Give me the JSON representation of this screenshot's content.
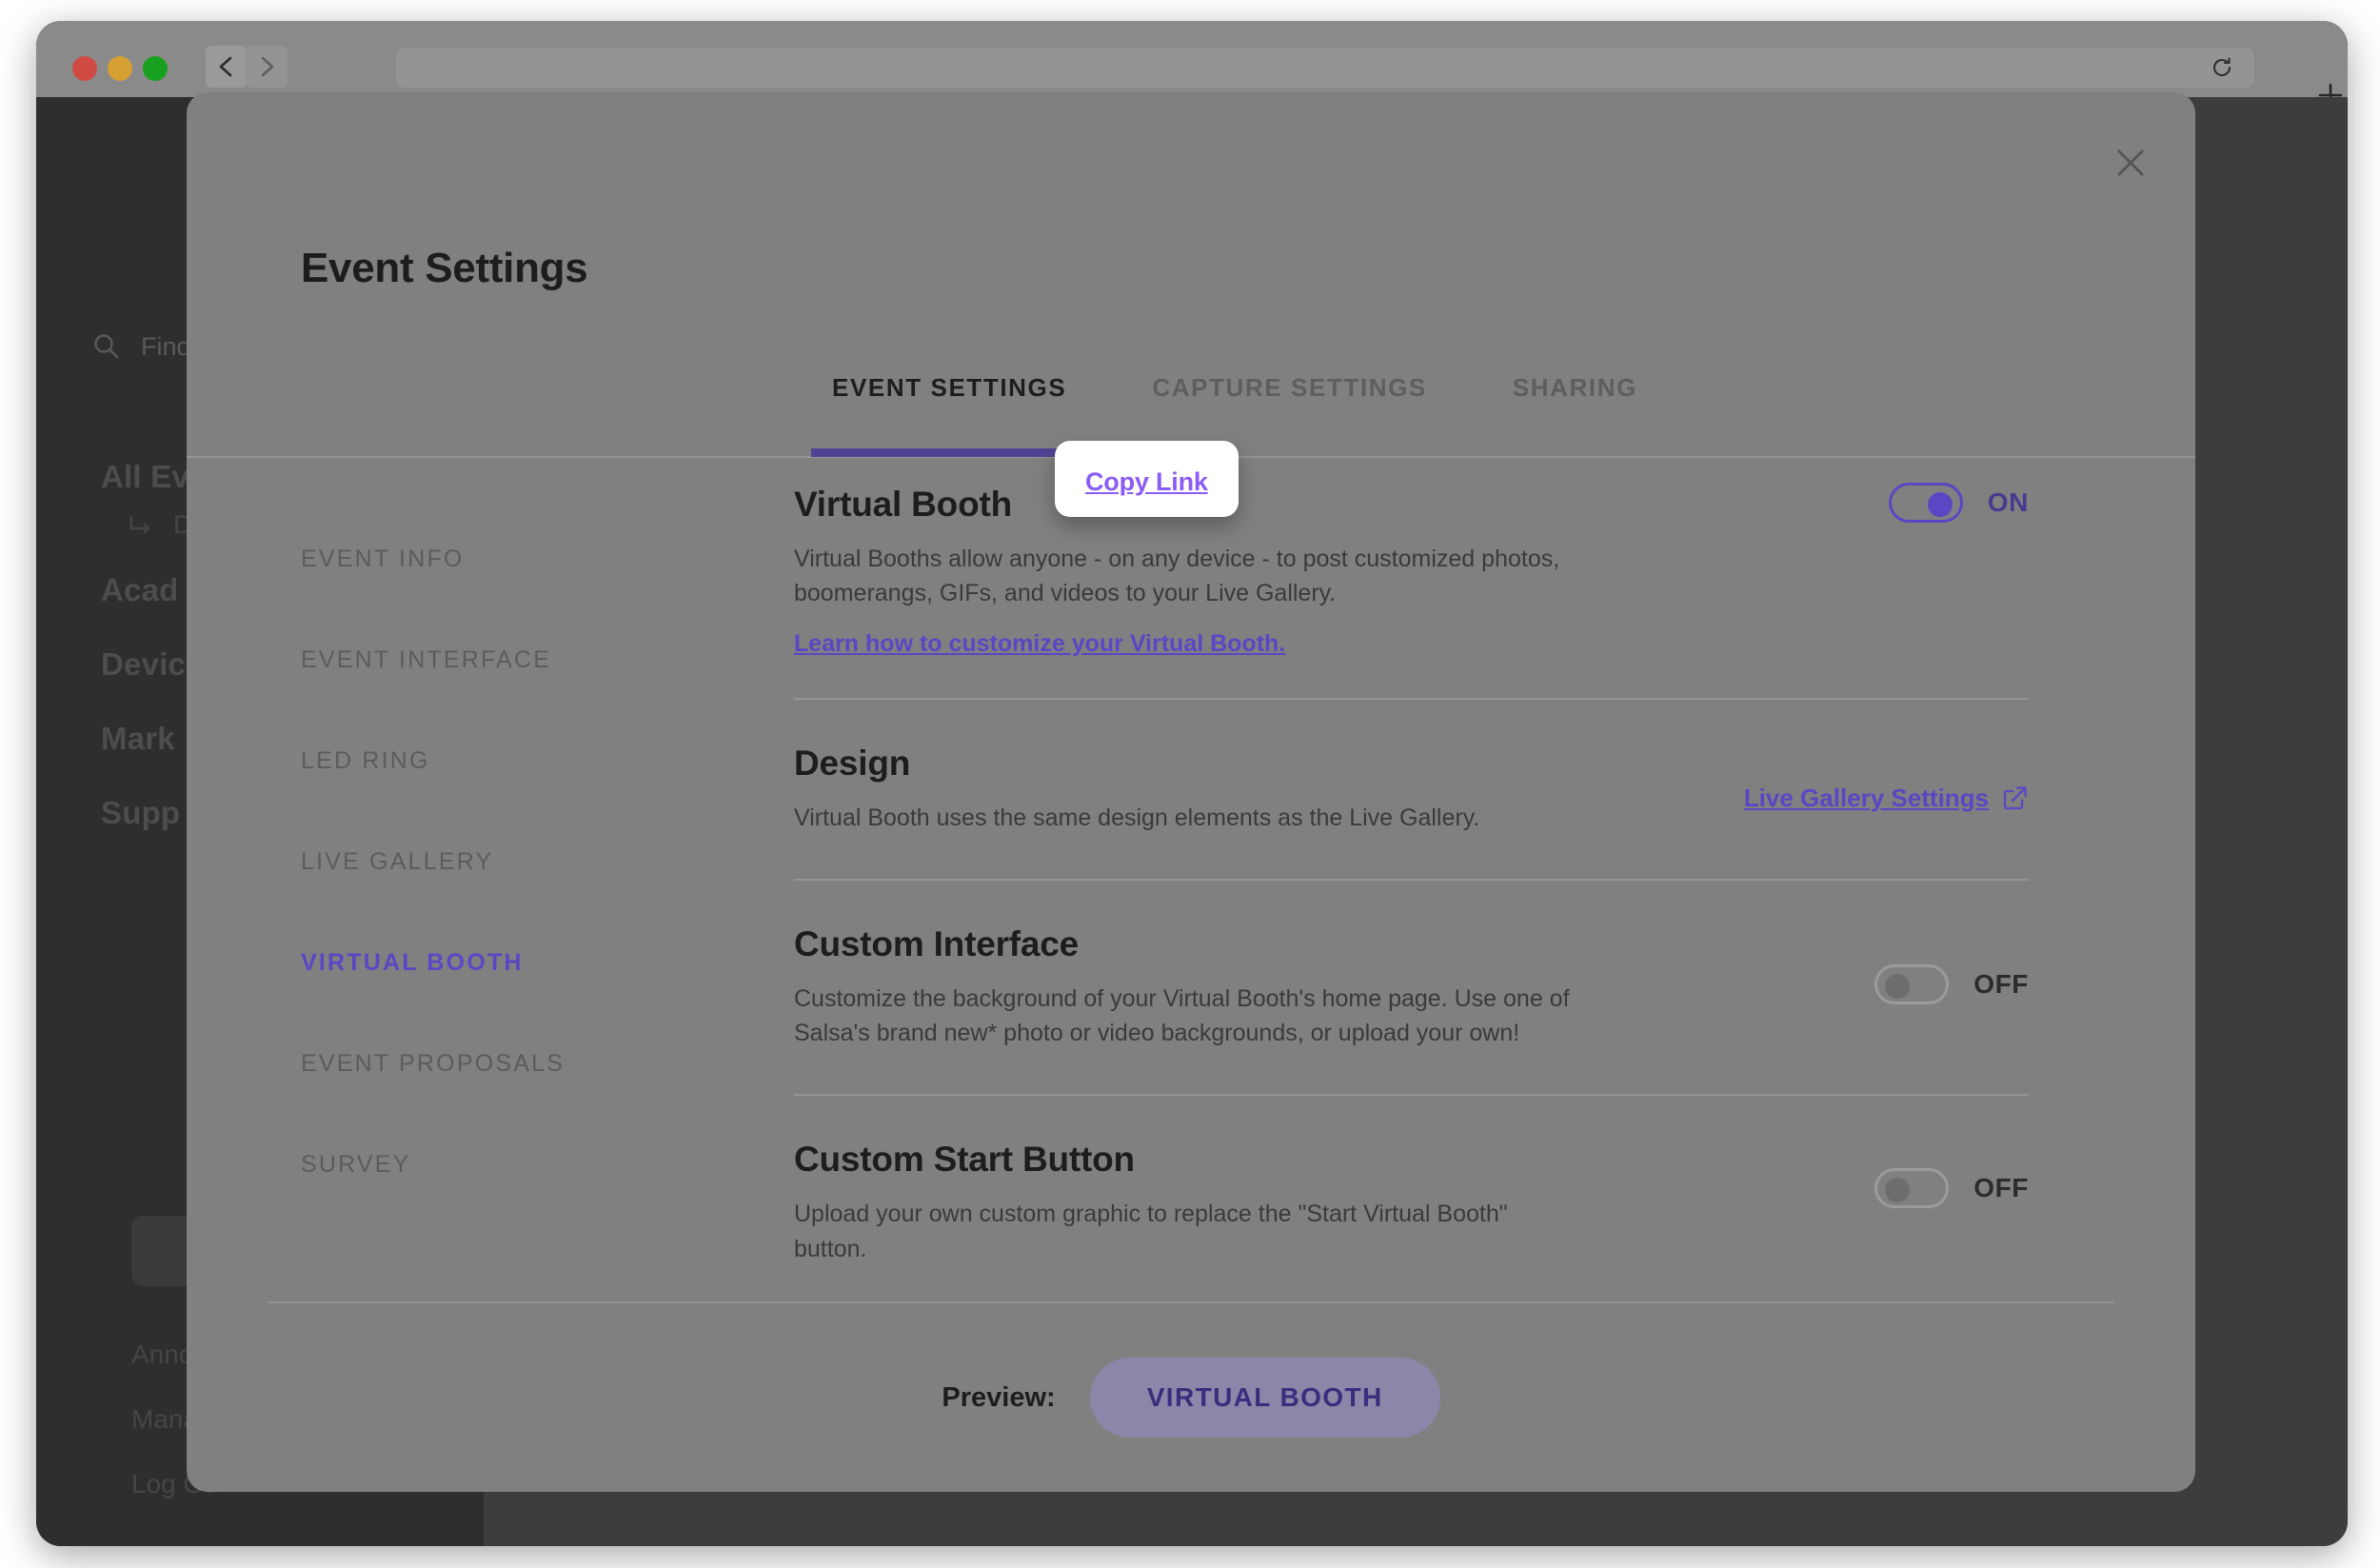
{
  "browser": {
    "back_icon": "chevron-left-icon",
    "forward_icon": "chevron-right-icon",
    "reload_icon": "reload-icon",
    "newtab_icon": "plus-icon",
    "address_value": ""
  },
  "background_app": {
    "search_placeholder": "Find...",
    "nav_items": [
      "All Ev",
      "Acad",
      "Devic",
      "Mark",
      "Supp"
    ],
    "nav_sub": "Do",
    "footer_items": [
      "Annou",
      "Manag",
      "Log Ou"
    ]
  },
  "modal": {
    "title": "Event Settings",
    "close_icon": "close-icon",
    "tabs": [
      {
        "label": "EVENT SETTINGS",
        "active": true
      },
      {
        "label": "CAPTURE SETTINGS",
        "active": false
      },
      {
        "label": "SHARING",
        "active": false
      }
    ],
    "side_nav": [
      {
        "label": "EVENT INFO",
        "active": false
      },
      {
        "label": "EVENT INTERFACE",
        "active": false
      },
      {
        "label": "LED RING",
        "active": false
      },
      {
        "label": "LIVE GALLERY",
        "active": false
      },
      {
        "label": "VIRTUAL BOOTH",
        "active": true
      },
      {
        "label": "EVENT PROPOSALS",
        "active": false
      },
      {
        "label": "SURVEY",
        "active": false
      }
    ],
    "sections": {
      "virtual_booth": {
        "heading": "Virtual Booth",
        "tooltip_label": "Copy Link",
        "description": "Virtual Booths allow anyone - on any device - to post customized photos, boomerangs, GIFs, and videos to your Live Gallery.",
        "learn_link": "Learn how to customize your Virtual Booth.",
        "toggle_state": "ON"
      },
      "design": {
        "heading": "Design",
        "description": "Virtual Booth uses the same design elements as the Live Gallery.",
        "link_label": "Live Gallery Settings",
        "link_icon": "external-link-icon"
      },
      "custom_interface": {
        "heading": "Custom Interface",
        "description": "Customize the background of your Virtual Booth's home page. Use one of Salsa's brand new* photo or video backgrounds, or upload your own!",
        "toggle_state": "OFF"
      },
      "custom_start_button": {
        "heading": "Custom Start Button",
        "description": "Upload your own custom graphic to replace the \"Start Virtual Booth\" button.",
        "toggle_state": "OFF"
      }
    },
    "footer": {
      "preview_label": "Preview:",
      "preview_button": "VIRTUAL BOOTH"
    }
  },
  "colors": {
    "accent_purple": "#5b46c4",
    "tab_underline": "#514394",
    "tooltip_link": "#8b5cf6",
    "modal_bg": "#808080",
    "preview_button_bg": "#8c86a8",
    "preview_button_text": "#3b2d7d"
  }
}
